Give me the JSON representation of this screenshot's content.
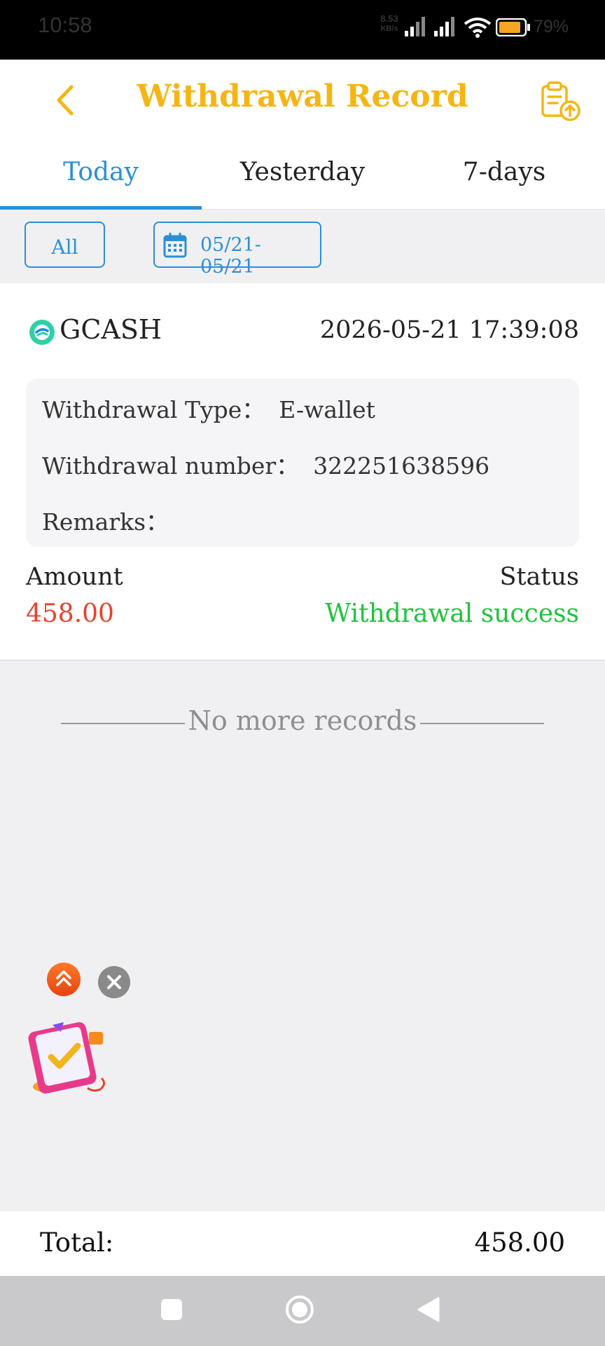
{
  "status_bar": {
    "time": "10:58",
    "net_speed_value": "8.53",
    "net_speed_unit": "KB/s",
    "battery_percent": "79%"
  },
  "header": {
    "title": "Withdrawal Record",
    "back_icon": "chevron-left-icon",
    "record_icon": "clipboard-upload-icon",
    "accent_color": "#f5b614"
  },
  "tabs": [
    {
      "label": "Today",
      "active": true
    },
    {
      "label": "Yesterday",
      "active": false
    },
    {
      "label": "7-days",
      "active": false
    }
  ],
  "filters": {
    "type_label": "All",
    "date_range": "05/21- 05/21",
    "date_icon": "calendar-icon"
  },
  "records": [
    {
      "method": "GCASH",
      "method_icon": "gcash-logo-icon",
      "datetime": "2026-05-21 17:39:08",
      "type_label": "Withdrawal Type：",
      "type_value": "E-wallet",
      "number_label": "Withdrawal number：",
      "number_value": "322251638596",
      "remarks_label": "Remarks：",
      "remarks_value": "",
      "amount_label": "Amount",
      "amount_value": "458.00",
      "status_label": "Status",
      "status_value": "Withdrawal success",
      "amount_color": "#e8412d",
      "status_color": "#21c23c"
    }
  ],
  "list_end_text": "No more records",
  "floating": {
    "scroll_top_icon": "double-chevron-up-icon",
    "close_icon": "close-icon",
    "gift_icon": "gift-checklist-icon"
  },
  "footer": {
    "total_label": "Total:",
    "total_value": "458.00"
  },
  "navbar": {
    "recents_icon": "square-icon",
    "home_icon": "circle-icon",
    "back_icon": "triangle-back-icon"
  }
}
